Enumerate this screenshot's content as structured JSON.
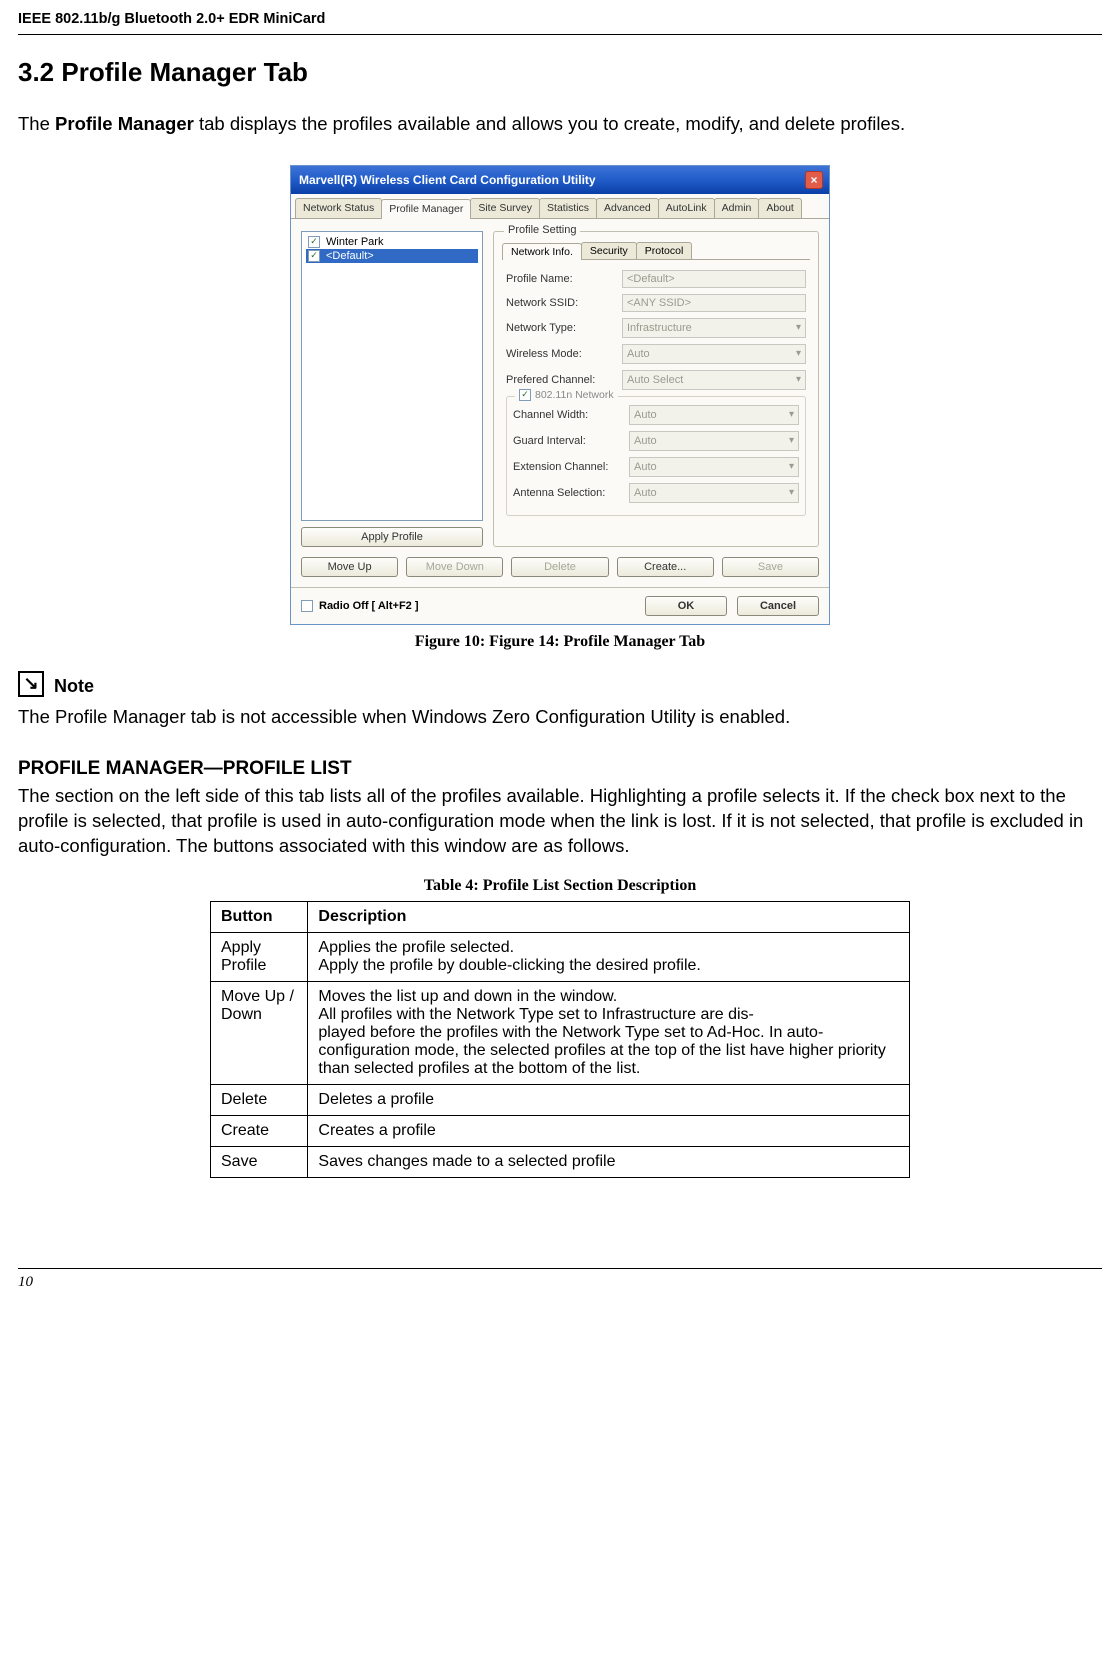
{
  "header": "IEEE 802.11b/g Bluetooth 2.0+ EDR MiniCard",
  "section_title": "3.2 Profile Manager Tab",
  "intro_line_a": "The ",
  "intro_bold": "Profile Manager",
  "intro_line_b": " tab displays the profiles available and allows you to create, modify, and delete profiles.",
  "dialog": {
    "title": "Marvell(R) Wireless Client Card Configuration Utility",
    "tabs": [
      "Network Status",
      "Profile Manager",
      "Site Survey",
      "Statistics",
      "Advanced",
      "AutoLink",
      "Admin",
      "About"
    ],
    "active_tab": "Profile Manager",
    "profile_items": [
      {
        "label": "Winter Park",
        "checked": true,
        "selected": false
      },
      {
        "label": "<Default>",
        "checked": true,
        "selected": true
      }
    ],
    "apply_label": "Apply Profile",
    "ps_legend": "Profile Setting",
    "ps_tabs": [
      "Network Info.",
      "Security",
      "Protocol"
    ],
    "ps_active": "Network Info.",
    "fields": {
      "profile_name": {
        "label": "Profile Name:",
        "value": "<Default>"
      },
      "ssid": {
        "label": "Network SSID:",
        "value": "<ANY SSID>"
      },
      "ntype": {
        "label": "Network Type:",
        "value": "Infrastructure"
      },
      "wmode": {
        "label": "Wireless Mode:",
        "value": "Auto"
      },
      "pchannel": {
        "label": "Prefered Channel:",
        "value": "Auto Select"
      }
    },
    "subgroup_legend": "802.11n Network",
    "subfields": {
      "cwidth": {
        "label": "Channel Width:",
        "value": "Auto"
      },
      "gint": {
        "label": "Guard Interval:",
        "value": "Auto"
      },
      "extch": {
        "label": "Extension Channel:",
        "value": "Auto"
      },
      "ant": {
        "label": "Antenna Selection:",
        "value": "Auto"
      }
    },
    "btnrow": [
      "Move Up",
      "Move Down",
      "Delete",
      "Create...",
      "Save"
    ],
    "radio_off": "Radio Off  [ Alt+F2 ]",
    "ok": "OK",
    "cancel": "Cancel"
  },
  "figure_caption": "Figure 10: Figure 14: Profile Manager Tab",
  "note_label": "Note",
  "note_text": "The Profile Manager tab is not accessible when Windows Zero Configuration Utility is enabled.",
  "subhead": "PROFILE MANAGER—PROFILE LIST",
  "profile_list_para": "The section on the left side of this tab lists all of the profiles available. Highlighting a profile selects it. If the check box next to the profile is selected, that profile is used in auto-configuration mode when the link is lost. If it is not selected, that profile is excluded in auto-configuration. The buttons associated with this window are as follows.",
  "table_caption": "Table 4: Profile List Section Description",
  "table": {
    "headers": [
      "Button",
      "Description"
    ],
    "rows": [
      {
        "btn": "Apply Profile",
        "desc": "Applies the profile selected.\nApply the profile by double-clicking the desired profile."
      },
      {
        "btn": "Move Up / Down",
        "desc": "Moves the list up and down in the window.\nAll profiles with the Network Type set to Infrastructure are dis-\nplayed before the profiles with the Network Type set to Ad-Hoc. In auto-configuration mode, the selected profiles at the top of the list have higher priority than selected profiles at the bottom of the list."
      },
      {
        "btn": "Delete",
        "desc": "Deletes a profile"
      },
      {
        "btn": "Create",
        "desc": "Creates a profile"
      },
      {
        "btn": "Save",
        "desc": "Saves changes made to a selected profile"
      }
    ]
  },
  "page_number": "10"
}
